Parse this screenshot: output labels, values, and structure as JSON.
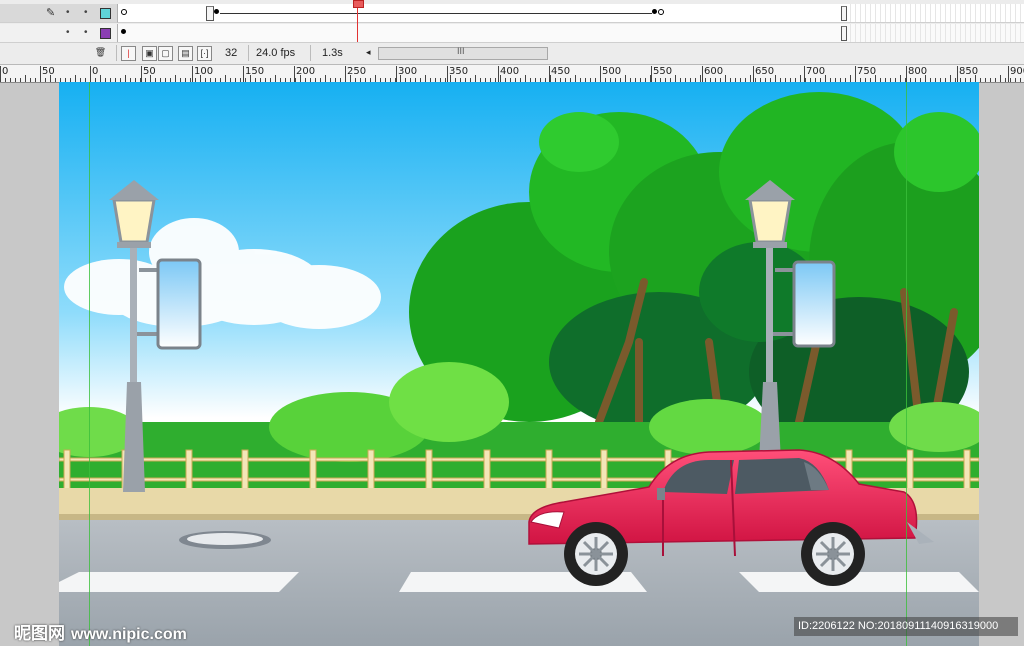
{
  "timeline": {
    "layers": [
      {
        "color": "#5fd3d8",
        "active": true
      },
      {
        "color": "#8b3fb3",
        "active": false
      }
    ],
    "current_frame": "32",
    "frame_rate": "24.0 fps",
    "elapsed_time": "1.3s",
    "scroll_grip": "III"
  },
  "ruler": {
    "labels": [
      "0",
      "50",
      "0",
      "50",
      "100",
      "150",
      "200",
      "250",
      "300",
      "350",
      "400",
      "450",
      "500",
      "550",
      "600",
      "650",
      "700",
      "750",
      "800",
      "850",
      "900"
    ]
  },
  "watermark": {
    "brand": "昵图网",
    "site": "www.nipic.com",
    "id_text": "ID:2206122 NO:20180911140916319000"
  },
  "colors": {
    "sky_top": "#1fb6f0",
    "tree_green": "#27b52a",
    "car_body": "#e8224e",
    "road": "#a9b1b8",
    "sidewalk": "#e8d9a8"
  }
}
